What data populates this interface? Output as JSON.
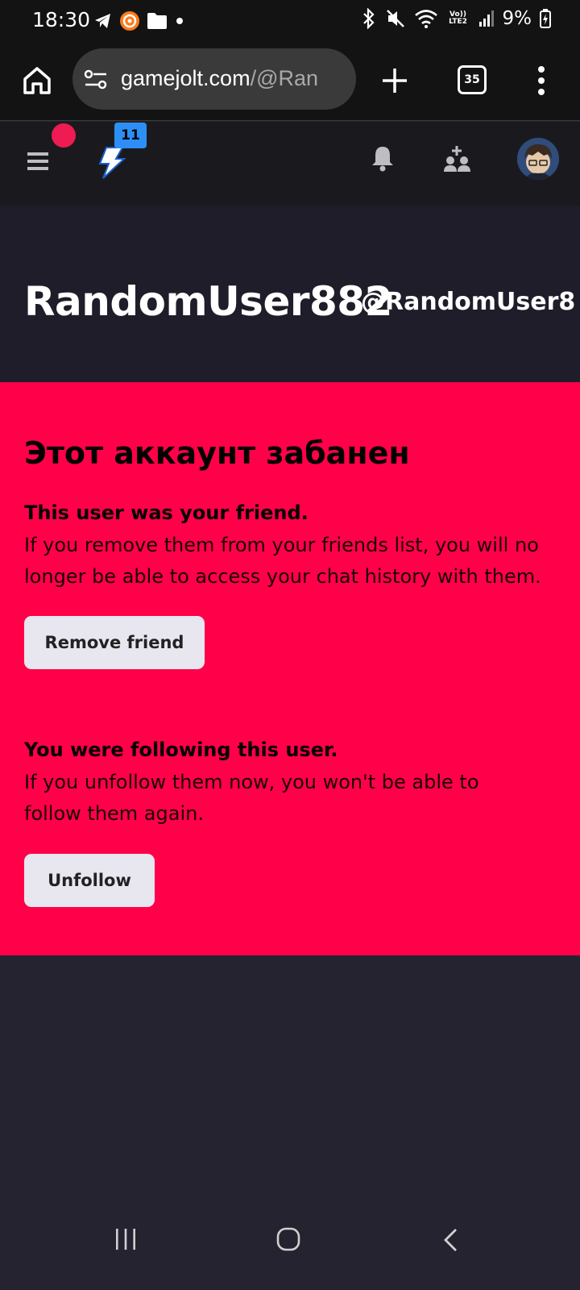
{
  "status_bar": {
    "time": "18:30",
    "network": "Vo)) LTE2",
    "battery": "9%"
  },
  "browser": {
    "url_host": "gamejolt.com",
    "url_path": "/@Ran",
    "tab_count": "35"
  },
  "header": {
    "badge_count": "11"
  },
  "profile": {
    "display_name": "RandomUser882",
    "username": "@RandomUser8"
  },
  "ban_notice": {
    "title": "Этот аккаунт забанен",
    "friend_heading": "This user was your friend.",
    "friend_text": "If you remove them from your friends list, you will no longer be able to access your chat history with them.",
    "remove_friend_label": "Remove friend",
    "follow_heading": "You were following this user.",
    "follow_text": "If you unfollow them now, you won't be able to follow them again.",
    "unfollow_label": "Unfollow"
  },
  "colors": {
    "ban_background": "#ff0049",
    "page_background": "#25232f",
    "notification_dot": "#ef1b53",
    "badge": "#2d8ff5"
  }
}
